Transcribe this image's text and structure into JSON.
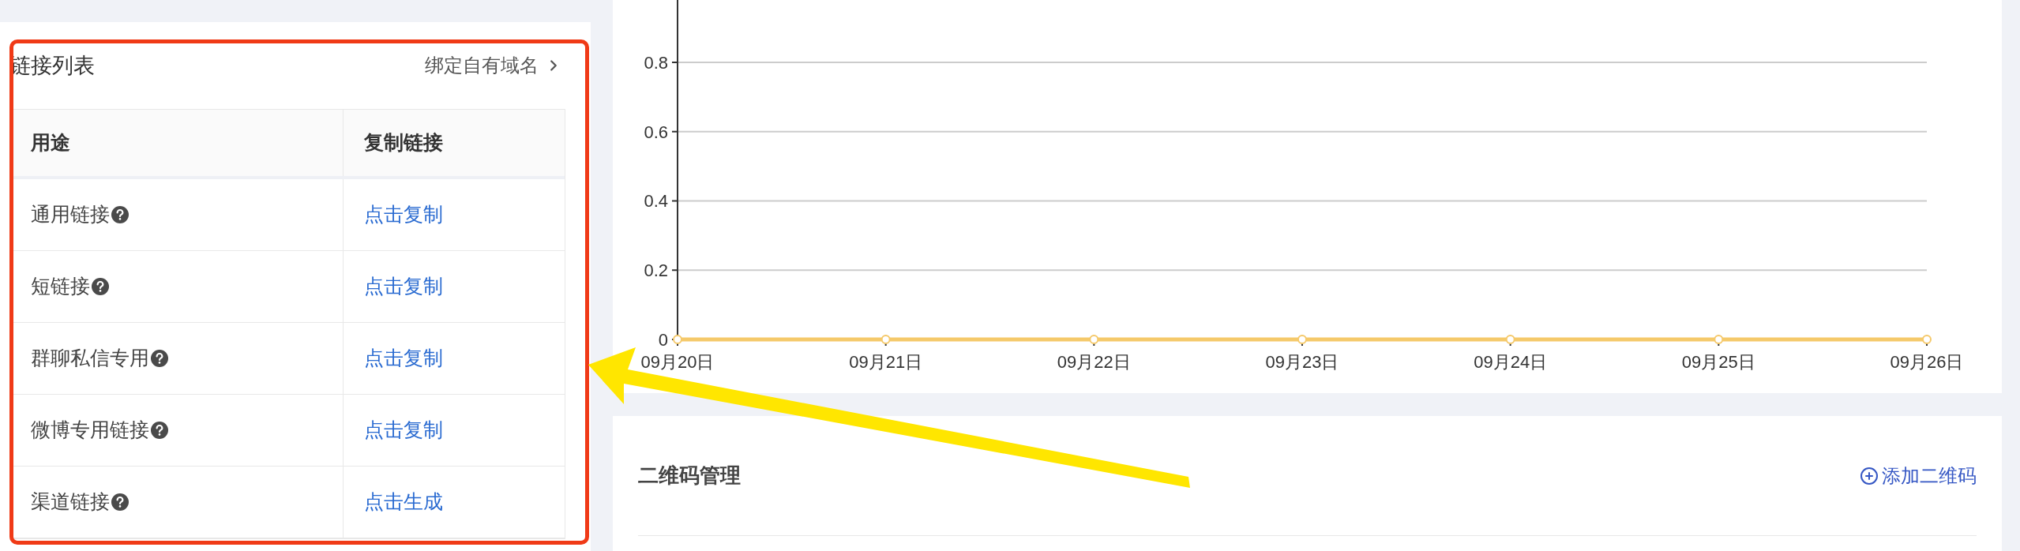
{
  "links_panel": {
    "title": "链接列表",
    "bind_link": "绑定自有域名",
    "table": {
      "columns": [
        "用途",
        "复制链接"
      ],
      "rows": [
        {
          "purpose": "通用链接",
          "action": "点击复制"
        },
        {
          "purpose": "短链接",
          "action": "点击复制"
        },
        {
          "purpose": "群聊私信专用",
          "action": "点击复制"
        },
        {
          "purpose": "微博专用链接",
          "action": "点击复制"
        },
        {
          "purpose": "渠道链接",
          "action": "点击生成"
        }
      ]
    }
  },
  "chart": {
    "chart_data": {
      "type": "line",
      "categories": [
        "09月20日",
        "09月21日",
        "09月22日",
        "09月23日",
        "09月24日",
        "09月25日",
        "09月26日"
      ],
      "series": [
        {
          "color": "#f5c96a",
          "marker": "circle",
          "values": [
            0,
            0,
            0,
            0,
            0,
            0,
            0
          ]
        }
      ],
      "ylim": [
        0,
        0.98
      ],
      "yticks": [
        0,
        0.2,
        0.4,
        0.6,
        0.8
      ],
      "grid": true
    }
  },
  "qr_panel": {
    "title": "二维码管理",
    "add_button": "添加二维码"
  }
}
